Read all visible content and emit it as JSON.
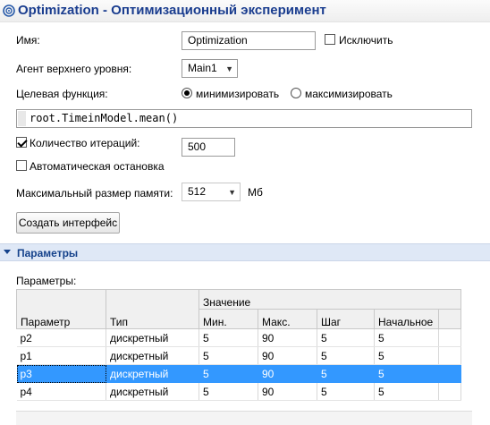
{
  "window": {
    "title": "Optimization - Оптимизационный эксперимент",
    "icon": "optimization-icon"
  },
  "form": {
    "name_label": "Имя:",
    "name_value": "Optimization",
    "exclude_label": "Исключить",
    "agent_label": "Агент верхнего уровня:",
    "agent_value": "Main1",
    "objective_label": "Целевая функция:",
    "minimize_label": "минимизировать",
    "maximize_label": "максимизировать",
    "objective_selected": "минимизировать",
    "expression": "root.TimeinModel.mean()",
    "iterations_label": "Количество итераций:",
    "iterations_checked": true,
    "iterations_value": "500",
    "autostop_label": "Автоматическая остановка",
    "autostop_checked": false,
    "memory_label": "Максимальный размер памяти:",
    "memory_value": "512",
    "memory_unit": "Мб",
    "create_ui_label": "Создать интерфейс"
  },
  "section": {
    "title": "Параметры"
  },
  "params": {
    "label": "Параметры:",
    "columns": {
      "param": "Параметр",
      "type": "Тип",
      "value_group": "Значение",
      "min": "Мин.",
      "max": "Макс.",
      "step": "Шаг",
      "initial": "Начальное"
    },
    "rows": [
      {
        "name": "p2",
        "type": "дискретный",
        "min": "5",
        "max": "90",
        "step": "5",
        "initial": "5",
        "selected": false
      },
      {
        "name": "p1",
        "type": "дискретный",
        "min": "5",
        "max": "90",
        "step": "5",
        "initial": "5",
        "selected": false
      },
      {
        "name": "p3",
        "type": "дискретный",
        "min": "5",
        "max": "90",
        "step": "5",
        "initial": "5",
        "selected": true
      },
      {
        "name": "p4",
        "type": "дискретный",
        "min": "5",
        "max": "90",
        "step": "5",
        "initial": "5",
        "selected": false
      }
    ]
  },
  "colors": {
    "title": "#1a3d8f",
    "section_bg": "#dfe8f6",
    "selection": "#3398ff"
  }
}
